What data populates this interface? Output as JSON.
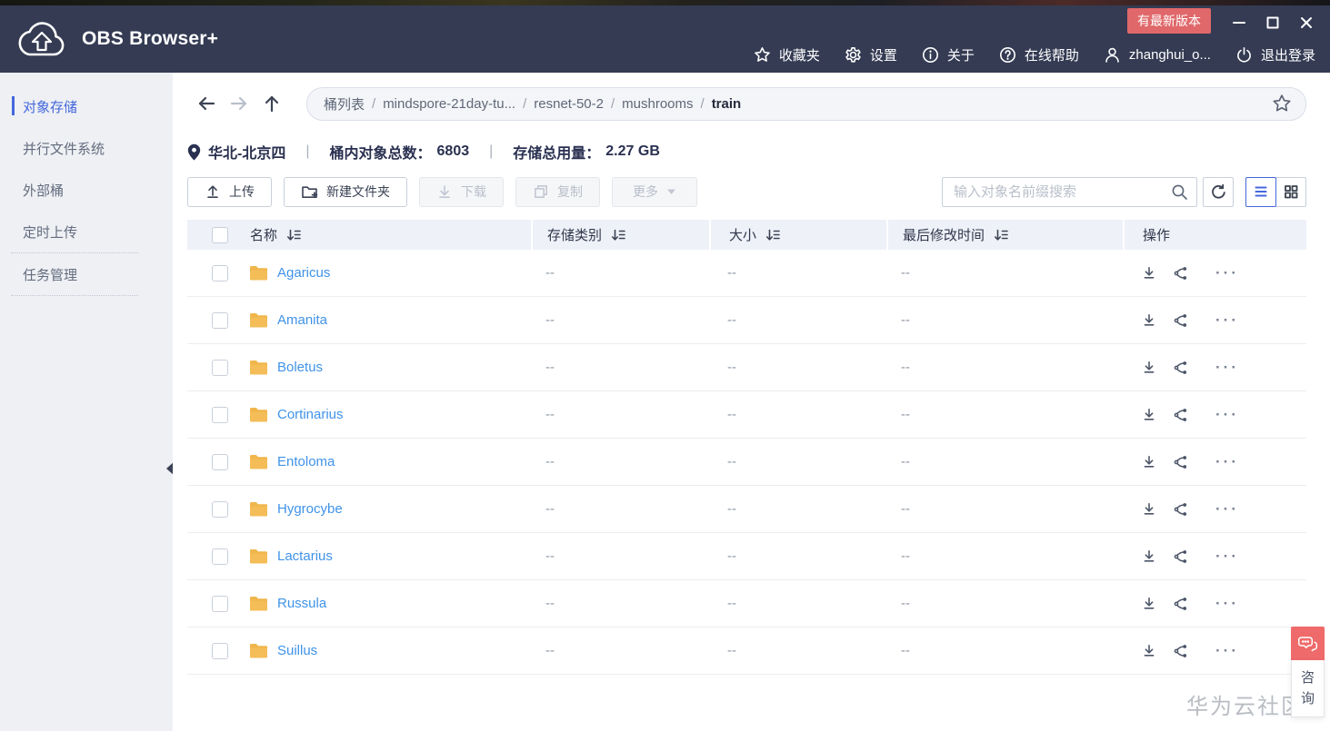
{
  "app": {
    "title": "OBS Browser+",
    "update_badge": "有最新版本",
    "logo": "cloud-upload-logo"
  },
  "titlebar": {
    "menu": [
      {
        "icon": "star",
        "label": "收藏夹"
      },
      {
        "icon": "gear",
        "label": "设置"
      },
      {
        "icon": "info",
        "label": "关于"
      },
      {
        "icon": "help",
        "label": "在线帮助"
      },
      {
        "icon": "user",
        "label": "zhanghui_o..."
      },
      {
        "icon": "power",
        "label": "退出登录"
      }
    ],
    "window_controls": [
      {
        "icon": "minimize",
        "name": "minimize-button"
      },
      {
        "icon": "maximize",
        "name": "maximize-button"
      },
      {
        "icon": "close",
        "name": "close-button"
      }
    ]
  },
  "sidebar": {
    "items": [
      {
        "label": "对象存储",
        "active": true,
        "divider": false
      },
      {
        "label": "并行文件系统",
        "active": false,
        "divider": false
      },
      {
        "label": "外部桶",
        "active": false,
        "divider": false
      },
      {
        "label": "定时上传",
        "active": false,
        "divider": true
      },
      {
        "label": "任务管理",
        "active": false,
        "divider": true
      }
    ]
  },
  "nav": {
    "breadcrumb": [
      "桶列表",
      "mindspore-21day-tu...",
      "resnet-50-2",
      "mushrooms",
      "train"
    ],
    "separator": "/"
  },
  "infobar": {
    "region": "华北-北京四",
    "separator": "|",
    "object_count_label": "桶内对象总数：",
    "object_count": "6803",
    "usage_label": "存储总用量：",
    "usage": "2.27 GB"
  },
  "toolbar": {
    "upload": "上传",
    "new_folder": "新建文件夹",
    "download": "下载",
    "copy": "复制",
    "more": "更多",
    "search_placeholder": "输入对象名前缀搜索"
  },
  "table": {
    "columns": [
      {
        "label": "名称",
        "sortable": true
      },
      {
        "label": "存储类别",
        "sortable": true
      },
      {
        "label": "大小",
        "sortable": true
      },
      {
        "label": "最后修改时间",
        "sortable": true
      },
      {
        "label": "操作",
        "sortable": false
      }
    ],
    "rows": [
      {
        "name": "Agaricus",
        "storage_class": "--",
        "size": "--",
        "modified": "--"
      },
      {
        "name": "Amanita",
        "storage_class": "--",
        "size": "--",
        "modified": "--"
      },
      {
        "name": "Boletus",
        "storage_class": "--",
        "size": "--",
        "modified": "--"
      },
      {
        "name": "Cortinarius",
        "storage_class": "--",
        "size": "--",
        "modified": "--"
      },
      {
        "name": "Entoloma",
        "storage_class": "--",
        "size": "--",
        "modified": "--"
      },
      {
        "name": "Hygrocybe",
        "storage_class": "--",
        "size": "--",
        "modified": "--"
      },
      {
        "name": "Lactarius",
        "storage_class": "--",
        "size": "--",
        "modified": "--"
      },
      {
        "name": "Russula",
        "storage_class": "--",
        "size": "--",
        "modified": "--"
      },
      {
        "name": "Suillus",
        "storage_class": "--",
        "size": "--",
        "modified": "--"
      }
    ],
    "row_ops_icons": [
      "download-row",
      "share",
      "more-ellipsis"
    ]
  },
  "footer": {
    "watermark": "华为云社区",
    "chat_label": "咨询"
  },
  "colors": {
    "titlebar": "#343b53",
    "badge": "#e0686a",
    "accent_blue": "#4468dc",
    "link_blue": "#3f93e8",
    "folder_yellow": "#f0b64b",
    "chat_red": "#ef6a6a"
  }
}
